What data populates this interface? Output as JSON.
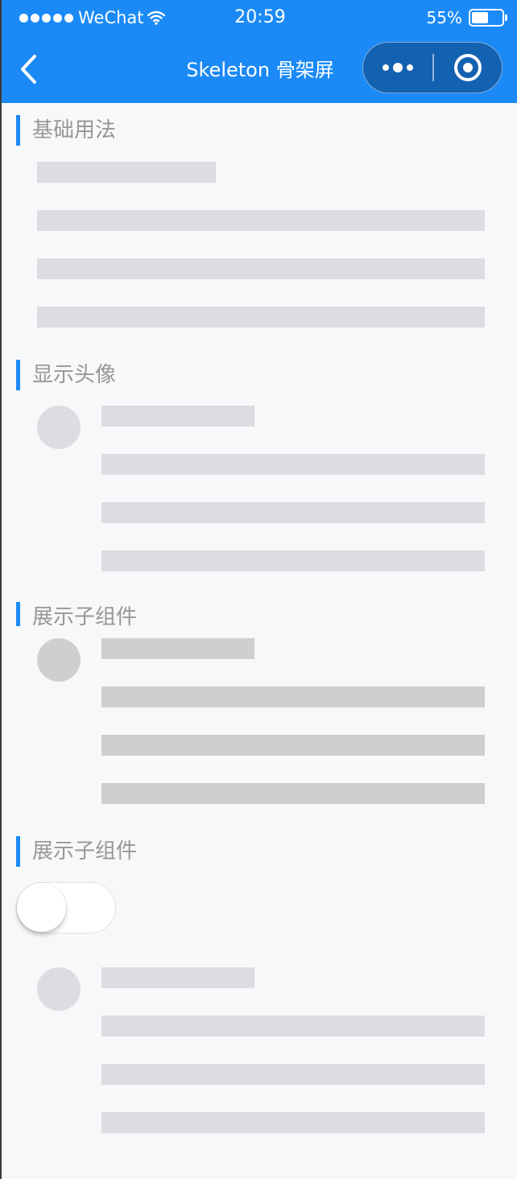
{
  "status_bar": {
    "carrier": "WeChat",
    "time": "20:59",
    "battery_percent": "55%",
    "battery_level": 0.55,
    "signal_icon": "signal-dots-icon",
    "wifi_icon": "wifi-icon",
    "battery_icon": "battery-icon"
  },
  "nav": {
    "title": "Skeleton 骨架屏",
    "back_icon": "chevron-left-icon",
    "more_icon": "more-dots-icon",
    "close_icon": "target-circle-icon",
    "color": "#1b8af6"
  },
  "sections": [
    {
      "title": "基础用法"
    },
    {
      "title": "显示头像"
    },
    {
      "title": "展示子组件"
    },
    {
      "title": "展示子组件"
    }
  ],
  "switch": {
    "checked": false
  },
  "colors": {
    "accent": "#1b8af6",
    "skeleton": "#dcdde0",
    "skeleton_animating": "#cfcfd1",
    "background": "#f7f8fa",
    "section_title": "#969799"
  }
}
